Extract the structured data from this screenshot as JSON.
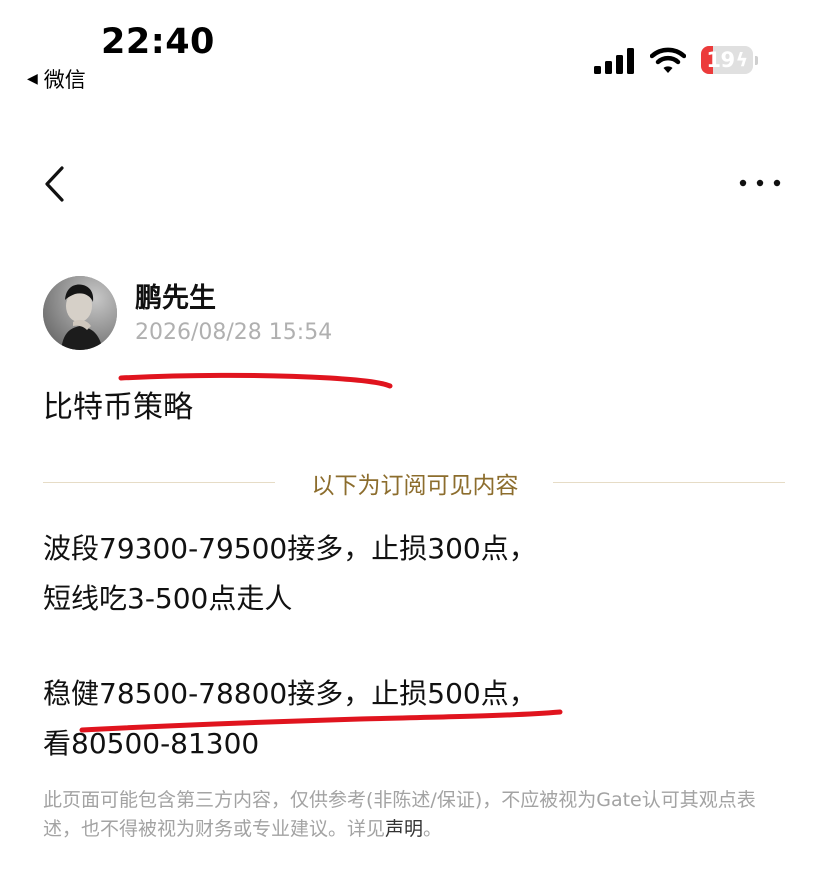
{
  "status_bar": {
    "time": "22:40",
    "back_app": "微信",
    "battery": "19"
  },
  "nav": {
    "back_icon": "chevron-left-icon",
    "more_icon": "more-horizontal-icon"
  },
  "post": {
    "author": "鹏先生",
    "timestamp": "2026/08/28 15:54",
    "title": "比特币策略",
    "subscriber_divider": "以下为订阅可见内容",
    "lines": [
      "波段79300-79500接多，止损300点，",
      "短线吃3-500点走人",
      "稳健78500-78800接多，止损500点，",
      "看80500-81300"
    ],
    "disclaimer": "此页面可能包含第三方内容，仅供参考(非陈述/保证)，不应被视为Gate认可其观点表述，也不得被视为财务或专业建议。详见",
    "disclaimer_link": "声明",
    "disclaimer_end": "。"
  },
  "colors": {
    "annotation": "#e0141e",
    "divider_text": "#8c6d2d",
    "battery_fill": "#ec3b3b"
  }
}
